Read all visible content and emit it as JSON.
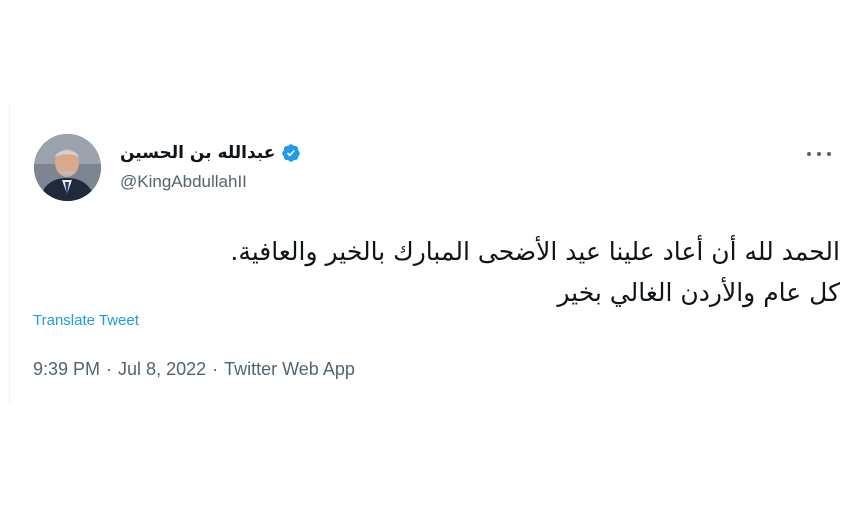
{
  "tweet": {
    "author": {
      "name": "عبدالله بن الحسين",
      "handle": "@KingAbdullahII",
      "verified": true
    },
    "text_lines": [
      "الحمد لله أن أعاد علينا عيد الأضحى المبارك بالخير والعافية.",
      "كل عام والأردن الغالي بخير"
    ],
    "translate_label": "Translate Tweet",
    "time": "9:39 PM",
    "date": "Jul 8, 2022",
    "separator": "·",
    "source": "Twitter Web App"
  },
  "colors": {
    "text": "#0f1419",
    "secondary": "#536471",
    "link": "#1d9bf0",
    "verified": "#1d9bf0"
  },
  "icons": {
    "verified": "verified-badge-icon",
    "more": "more-horizontal-icon"
  }
}
